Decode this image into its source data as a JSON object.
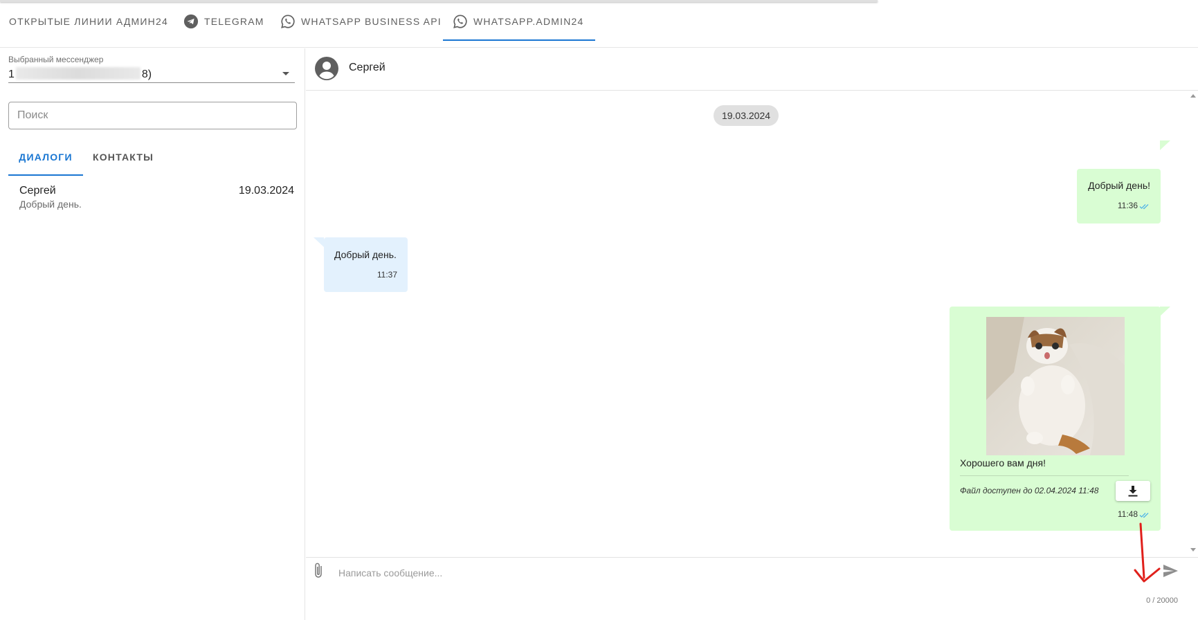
{
  "tabs": [
    {
      "label": "ОТКРЫТЫЕ ЛИНИИ АДМИН24",
      "icon": "none"
    },
    {
      "label": "TELEGRAM",
      "icon": "telegram-icon"
    },
    {
      "label": "WHATSAPP BUSINESS API",
      "icon": "whatsapp-icon"
    },
    {
      "label": "WHATSAPP.ADMIN24",
      "icon": "whatsapp-icon",
      "active": true
    }
  ],
  "sidebar": {
    "select_label": "Выбранный мессенджер",
    "select_value_start": "1",
    "select_value_end": "8)",
    "search_placeholder": "Поиск",
    "subtabs": [
      {
        "label": "ДИАЛОГИ",
        "active": true
      },
      {
        "label": "КОНТАКТЫ",
        "active": false
      }
    ],
    "dialogs": [
      {
        "name": "Сергей",
        "date": "19.03.2024",
        "preview": "Добрый день."
      }
    ]
  },
  "chat": {
    "title": "Сергей",
    "date_chip": "19.03.2024",
    "messages": [
      {
        "direction": "out",
        "text": "Добрый день!",
        "time": "11:36",
        "read": true
      },
      {
        "direction": "in",
        "text": "Добрый день.",
        "time": "11:37"
      },
      {
        "direction": "out",
        "caption": "Хорошего вам дня!",
        "file_note": "Файл доступен до 02.04.2024 11:48",
        "time": "11:48",
        "read": true
      }
    ],
    "composer_placeholder": "Написать сообщение...",
    "counter": "0 / 20000"
  },
  "colors": {
    "accent": "#1976d2",
    "out_bubble": "#d9fdd3",
    "in_bubble": "#e3f1fd",
    "check": "#4fb3e8",
    "annotation_arrow": "#e0201b"
  }
}
